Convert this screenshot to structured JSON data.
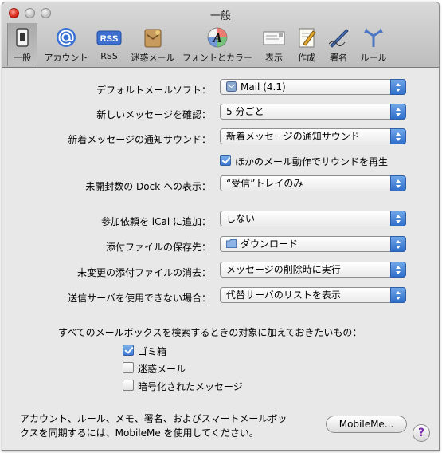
{
  "window": {
    "title": "一般"
  },
  "toolbar": {
    "items": [
      {
        "label": "一般",
        "icon": "general-switch-icon",
        "selected": true
      },
      {
        "label": "アカウント",
        "icon": "at-sign-icon"
      },
      {
        "label": "RSS",
        "icon": "rss-icon",
        "icon_text": "RSS"
      },
      {
        "label": "迷惑メール",
        "icon": "junk-mail-icon"
      },
      {
        "label": "フォントとカラー",
        "icon": "font-color-icon",
        "icon_text": "A"
      },
      {
        "label": "表示",
        "icon": "viewing-icon"
      },
      {
        "label": "作成",
        "icon": "composing-icon"
      },
      {
        "label": "署名",
        "icon": "signature-icon"
      },
      {
        "label": "ルール",
        "icon": "rules-icon"
      }
    ]
  },
  "settings": {
    "default_mail_app": {
      "label": "デフォルトメールソフト：",
      "value": "Mail (4.1)"
    },
    "check_new_mail": {
      "label": "新しいメッセージを確認：",
      "value": "5 分ごと"
    },
    "new_mail_sound": {
      "label": "新着メッセージの通知サウンド：",
      "value": "新着メッセージの通知サウンド"
    },
    "play_sounds": {
      "label": "ほかのメール動作でサウンドを再生",
      "checked": true
    },
    "dock_unread": {
      "label": "未開封数の Dock への表示：",
      "value": "“受信”トレイのみ"
    },
    "add_invitations": {
      "label": "参加依頼を iCal に追加：",
      "value": "しない"
    },
    "downloads_folder": {
      "label": "添付ファイルの保存先：",
      "value": "ダウンロード"
    },
    "remove_downloads": {
      "label": "未変更の添付ファイルの消去：",
      "value": "メッセージの削除時に実行"
    },
    "outgoing_unavailable": {
      "label": "送信サーバを使用できない場合：",
      "value": "代替サーバのリストを表示"
    }
  },
  "search_include": {
    "heading": "すべてのメールボックスを検索するときの対象に加えておきたいもの：",
    "options": [
      {
        "label": "ゴミ箱",
        "checked": true
      },
      {
        "label": "迷惑メール",
        "checked": false
      },
      {
        "label": "暗号化されたメッセージ",
        "checked": false
      }
    ]
  },
  "footer": {
    "note_line1": "アカウント、ルール、メモ、署名、およびスマートメールボッ",
    "note_line2": "クスを同期するには、MobileMe を使用してください。",
    "mobileme_button": "MobileMe...",
    "help_button": "?"
  },
  "colors": {
    "accent": "#2f6fcc",
    "help": "#7a2aa8"
  }
}
